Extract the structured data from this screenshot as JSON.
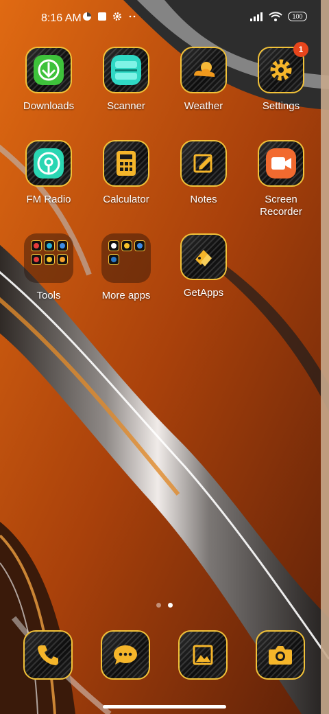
{
  "status_bar": {
    "time": "8:16 AM",
    "battery": "100",
    "icons_left": [
      "data-usage-icon",
      "square-notification-icon",
      "gear-icon",
      "more-dots-icon"
    ],
    "icons_right": [
      "signal-icon",
      "wifi-icon",
      "battery-icon"
    ]
  },
  "apps": [
    {
      "label": "Downloads",
      "icon": "download-icon"
    },
    {
      "label": "Scanner",
      "icon": "scanner-icon"
    },
    {
      "label": "Weather",
      "icon": "weather-icon"
    },
    {
      "label": "Settings",
      "icon": "gear-icon",
      "badge": "1"
    },
    {
      "label": "FM Radio",
      "icon": "radio-icon"
    },
    {
      "label": "Calculator",
      "icon": "calculator-icon"
    },
    {
      "label": "Notes",
      "icon": "notes-icon"
    },
    {
      "label": "Screen\nRecorder",
      "icon": "screen-recorder-icon"
    },
    {
      "label": "Tools",
      "icon": "folder-icon"
    },
    {
      "label": "More apps",
      "icon": "folder-icon"
    },
    {
      "label": "GetApps",
      "icon": "getapps-icon"
    }
  ],
  "dock": [
    {
      "name": "phone",
      "icon": "phone-icon"
    },
    {
      "name": "messages",
      "icon": "message-icon"
    },
    {
      "name": "gallery",
      "icon": "gallery-icon"
    },
    {
      "name": "camera",
      "icon": "camera-icon"
    }
  ],
  "pages": {
    "count": 2,
    "active": 2
  },
  "colors": {
    "accent": "#f2c239",
    "badge": "#e8451c",
    "wallpaper_orange": "#c9520e"
  }
}
